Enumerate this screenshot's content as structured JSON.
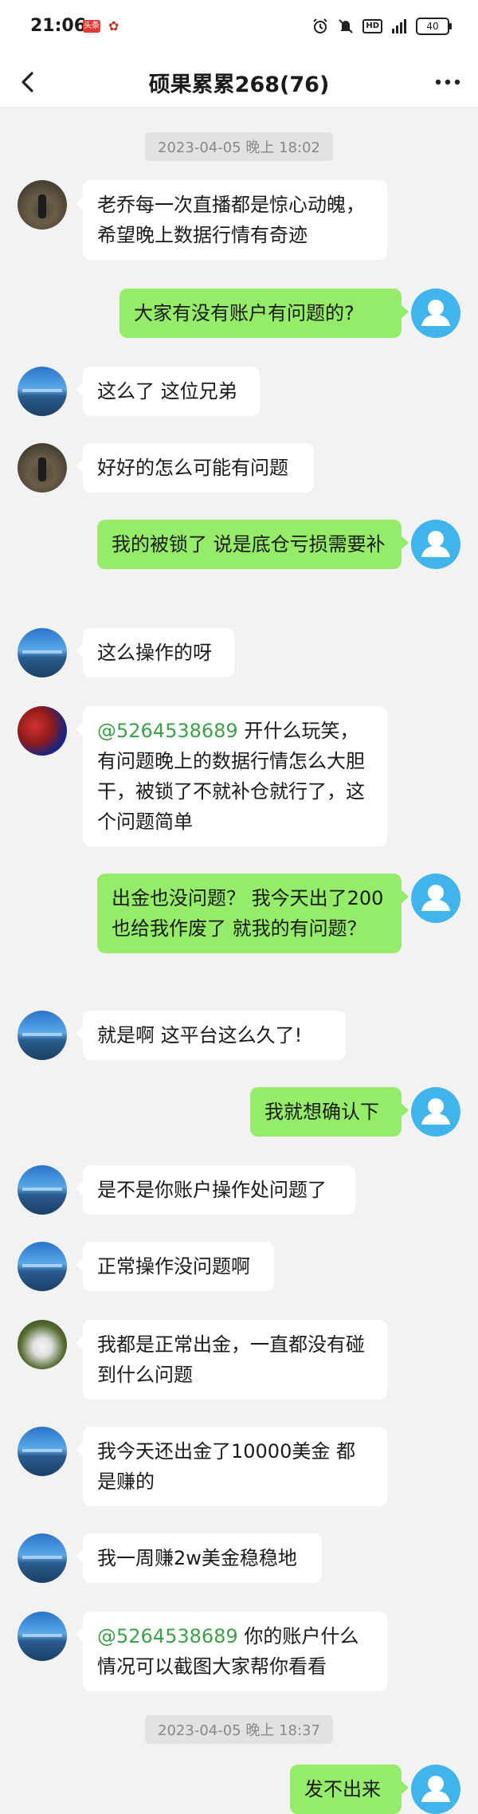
{
  "status_bar": {
    "time": "21:06",
    "app_badge": "头条",
    "network": "5G",
    "hd": "HD",
    "battery": "40"
  },
  "header": {
    "title": "硕果累累268(76)"
  },
  "timestamps": [
    "2023-04-05 晚上 18:02",
    "2023-04-05 晚上 18:37"
  ],
  "messages": [
    {
      "side": "left",
      "text": "老乔每一次直播都是惊心动魄，希望晚上数据行情有奇迹"
    },
    {
      "side": "right",
      "text": "大家有没有账户有问题的?"
    },
    {
      "side": "left",
      "text": "这么了 这位兄弟"
    },
    {
      "side": "left",
      "text": "好好的怎么可能有问题"
    },
    {
      "side": "right",
      "text": "我的被锁了 说是底仓亏损需要补"
    },
    {
      "side": "left",
      "text": "这么操作的呀"
    },
    {
      "side": "left",
      "mention": "@5264538689",
      "text": " 开什么玩笑，有问题晚上的数据行情怎么大胆干，被锁了不就补仓就行了，这个问题简单"
    },
    {
      "side": "right",
      "text": "出金也没问题？ 我今天出了200也给我作废了 就我的有问题？"
    },
    {
      "side": "left",
      "text": "就是啊  这平台这么久了!"
    },
    {
      "side": "right",
      "text": "我就想确认下"
    },
    {
      "side": "left",
      "text": "是不是你账户操作处问题了"
    },
    {
      "side": "left",
      "text": "正常操作没问题啊"
    },
    {
      "side": "left",
      "text": "我都是正常出金，一直都没有碰到什么问题"
    },
    {
      "side": "left",
      "text": "我今天还出金了10000美金 都是赚的"
    },
    {
      "side": "left",
      "text": "我一周赚2w美金稳稳地"
    },
    {
      "side": "left",
      "mention": "@5264538689",
      "text": " 你的账户什么情况可以截图大家帮你看看"
    },
    {
      "side": "right",
      "text": "发不出来"
    }
  ],
  "colors": {
    "self_bubble": "#95ec69",
    "other_bubble": "#ffffff",
    "mention": "#3ea14a",
    "self_avatar": "#42b4ec"
  }
}
